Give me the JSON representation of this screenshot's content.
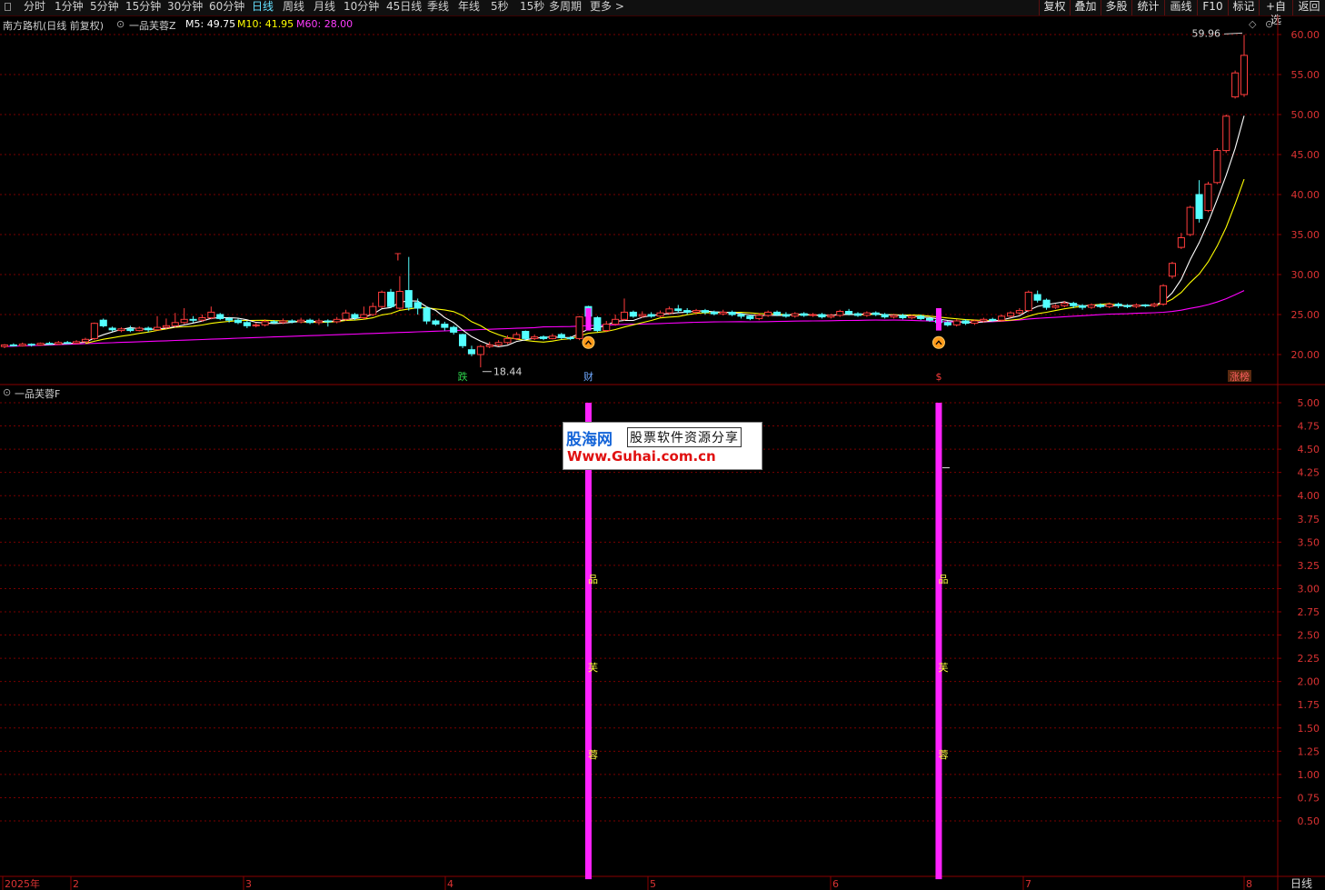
{
  "toolbar": {
    "periods": [
      "分时",
      "1分钟",
      "5分钟",
      "15分钟",
      "30分钟",
      "60分钟",
      "日线",
      "周线",
      "月线",
      "10分钟",
      "45日线",
      "季线",
      "年线",
      "5秒",
      "15秒",
      "多周期",
      "更多 >"
    ],
    "active_period": "日线",
    "right_buttons": [
      "复权",
      "叠加",
      "多股",
      "统计",
      "画线",
      "F10",
      "标记",
      "+自选",
      "返回"
    ]
  },
  "main_info": {
    "stock_label": "南方路机(日线 前复权)",
    "indicator_name": "一品芙蓉Z",
    "ma5_label": "M5: 49.75",
    "ma10_label": "M10: 41.95",
    "ma60_label": "M60: 28.00"
  },
  "sub_info": {
    "indicator_name": "一品芙蓉F"
  },
  "annotations": {
    "high_label": "59.96",
    "low_label": "18.44",
    "t_marker": "T",
    "bottom_markers": [
      "跌",
      "财",
      "$",
      "涨榜"
    ]
  },
  "sub_vertical_text": [
    "品",
    "芙",
    "蓉"
  ],
  "time_axis": {
    "labels": [
      "2025年",
      "2",
      "3",
      "4",
      "5",
      "6",
      "7",
      "8"
    ],
    "period_label": "日线"
  },
  "watermark": {
    "logo": "股海网",
    "slogan": "股票软件资源分享",
    "url": "Www.Guhai.com.cn"
  },
  "colors": {
    "up": "#ff3c3c",
    "down": "#54ffff",
    "ma5": "#ffffff",
    "ma10": "#ffff00",
    "ma60": "#ff00ff",
    "grid": "#7a0000",
    "signal": "#ff22ff"
  },
  "chart_data": [
    {
      "type": "candlestick",
      "title": "南方路机(日线 前复权)",
      "ylim": [
        18,
        62
      ],
      "y_ticks": [
        "60.00",
        "55.00",
        "50.00",
        "45.00",
        "40.00",
        "35.00",
        "30.00",
        "25.00",
        "20.00"
      ],
      "highest": 59.96,
      "lowest": 18.44,
      "series": [
        {
          "name": "M5",
          "last": 49.75
        },
        {
          "name": "M10",
          "last": 41.95
        },
        {
          "name": "M60",
          "last": 28.0
        }
      ],
      "candles": [
        [
          21.0,
          21.2,
          20.8,
          21.3
        ],
        [
          21.2,
          21.1,
          21.0,
          21.4
        ],
        [
          21.1,
          21.3,
          21.0,
          21.5
        ],
        [
          21.3,
          21.2,
          21.0,
          21.4
        ],
        [
          21.2,
          21.4,
          21.1,
          21.5
        ],
        [
          21.4,
          21.3,
          21.2,
          21.6
        ],
        [
          21.3,
          21.5,
          21.2,
          21.7
        ],
        [
          21.5,
          21.4,
          21.3,
          21.7
        ],
        [
          21.4,
          21.6,
          21.3,
          21.8
        ],
        [
          21.6,
          21.9,
          21.5,
          22.1
        ],
        [
          22.0,
          23.9,
          21.8,
          24.0
        ],
        [
          24.3,
          23.6,
          23.4,
          24.5
        ],
        [
          23.3,
          23.1,
          22.9,
          23.5
        ],
        [
          23.0,
          23.2,
          22.8,
          23.4
        ],
        [
          23.2,
          23.0,
          22.8,
          23.6
        ],
        [
          23.0,
          23.3,
          22.9,
          23.5
        ],
        [
          23.3,
          23.1,
          22.8,
          23.5
        ],
        [
          23.1,
          23.4,
          23.0,
          24.8
        ],
        [
          23.4,
          23.6,
          23.2,
          24.5
        ],
        [
          23.6,
          24.0,
          23.4,
          25.2
        ],
        [
          24.0,
          24.4,
          23.8,
          25.8
        ],
        [
          24.4,
          24.3,
          24.0,
          24.8
        ],
        [
          24.3,
          24.6,
          24.1,
          25.0
        ],
        [
          24.6,
          25.3,
          24.4,
          26.0
        ],
        [
          25.0,
          24.5,
          24.3,
          25.2
        ],
        [
          24.5,
          24.3,
          24.0,
          24.7
        ],
        [
          24.3,
          24.0,
          23.8,
          24.5
        ],
        [
          24.0,
          23.6,
          23.3,
          24.2
        ],
        [
          23.6,
          23.7,
          23.4,
          24.0
        ],
        [
          23.7,
          24.1,
          23.5,
          24.4
        ],
        [
          24.1,
          24.0,
          23.8,
          24.3
        ],
        [
          24.0,
          24.2,
          23.8,
          24.5
        ],
        [
          24.2,
          24.1,
          23.9,
          24.4
        ],
        [
          24.1,
          24.3,
          23.9,
          24.6
        ],
        [
          24.3,
          24.0,
          23.8,
          24.5
        ],
        [
          24.0,
          24.2,
          23.7,
          24.5
        ],
        [
          24.2,
          24.1,
          23.5,
          24.4
        ],
        [
          24.1,
          24.4,
          23.9,
          24.7
        ],
        [
          24.4,
          25.2,
          24.2,
          25.6
        ],
        [
          25.0,
          24.6,
          24.3,
          25.2
        ],
        [
          24.6,
          25.0,
          24.4,
          26.0
        ],
        [
          25.0,
          26.0,
          24.8,
          26.5
        ],
        [
          26.0,
          27.8,
          25.8,
          28.0
        ],
        [
          27.8,
          26.0,
          25.8,
          28.2
        ],
        [
          25.8,
          27.9,
          25.6,
          29.8
        ],
        [
          28.0,
          25.9,
          25.5,
          32.2
        ],
        [
          26.5,
          25.8,
          25.0,
          27.0
        ],
        [
          25.8,
          24.2,
          23.8,
          26.0
        ],
        [
          24.2,
          23.8,
          23.6,
          24.4
        ],
        [
          23.8,
          23.4,
          23.0,
          24.1
        ],
        [
          23.4,
          22.8,
          22.5,
          23.6
        ],
        [
          22.5,
          21.1,
          20.8,
          22.6
        ],
        [
          20.6,
          20.1,
          19.8,
          21.1
        ],
        [
          20.0,
          21.0,
          18.4,
          21.2
        ],
        [
          21.0,
          21.2,
          20.8,
          21.6
        ],
        [
          21.2,
          21.5,
          21.0,
          21.8
        ],
        [
          21.5,
          22.0,
          21.3,
          22.4
        ],
        [
          22.0,
          22.5,
          21.8,
          22.8
        ],
        [
          22.9,
          22.0,
          21.8,
          23.0
        ],
        [
          22.0,
          22.2,
          21.8,
          22.5
        ],
        [
          22.2,
          22.0,
          21.8,
          22.4
        ],
        [
          22.0,
          22.3,
          21.9,
          22.6
        ],
        [
          22.5,
          22.1,
          21.9,
          22.7
        ],
        [
          22.1,
          22.0,
          21.8,
          22.3
        ],
        [
          22.0,
          24.7,
          21.8,
          24.8
        ],
        [
          26.0,
          24.8,
          24.5,
          26.1
        ],
        [
          24.6,
          23.0,
          22.8,
          24.8
        ],
        [
          23.0,
          23.8,
          22.8,
          24.2
        ],
        [
          23.8,
          24.4,
          23.6,
          25.0
        ],
        [
          24.4,
          25.3,
          24.2,
          27.0
        ],
        [
          25.3,
          24.8,
          24.6,
          25.5
        ],
        [
          24.8,
          25.0,
          24.6,
          25.4
        ],
        [
          25.0,
          24.8,
          24.6,
          25.3
        ],
        [
          24.8,
          25.2,
          24.6,
          25.5
        ],
        [
          25.2,
          25.7,
          25.0,
          26.0
        ],
        [
          25.7,
          25.5,
          25.2,
          26.2
        ],
        [
          25.5,
          25.3,
          25.0,
          25.8
        ],
        [
          25.3,
          25.5,
          25.1,
          25.7
        ],
        [
          25.5,
          25.3,
          25.0,
          25.7
        ],
        [
          25.3,
          25.1,
          24.9,
          25.5
        ],
        [
          25.1,
          25.3,
          24.9,
          25.6
        ],
        [
          25.3,
          25.0,
          24.8,
          25.5
        ],
        [
          25.0,
          24.8,
          24.5,
          25.2
        ],
        [
          24.8,
          24.5,
          24.3,
          25.0
        ],
        [
          24.5,
          24.9,
          24.3,
          25.2
        ],
        [
          24.9,
          25.3,
          24.7,
          25.5
        ],
        [
          25.3,
          25.0,
          24.8,
          25.5
        ],
        [
          25.0,
          24.8,
          24.6,
          25.3
        ],
        [
          24.8,
          25.1,
          24.6,
          25.3
        ],
        [
          25.1,
          24.9,
          24.7,
          25.3
        ],
        [
          24.9,
          25.0,
          24.7,
          25.2
        ],
        [
          25.0,
          24.7,
          24.5,
          25.2
        ],
        [
          24.7,
          24.9,
          24.5,
          25.1
        ],
        [
          24.9,
          25.4,
          24.7,
          25.6
        ],
        [
          25.4,
          25.1,
          24.9,
          25.7
        ],
        [
          25.1,
          24.9,
          24.7,
          25.3
        ],
        [
          24.9,
          25.2,
          24.7,
          25.4
        ],
        [
          25.2,
          25.0,
          24.8,
          25.4
        ],
        [
          25.0,
          24.7,
          24.5,
          25.2
        ],
        [
          24.7,
          24.9,
          24.5,
          25.1
        ],
        [
          24.9,
          24.6,
          24.4,
          25.1
        ],
        [
          24.6,
          24.8,
          24.4,
          25.0
        ],
        [
          24.8,
          24.5,
          24.3,
          25.0
        ],
        [
          24.5,
          24.3,
          24.1,
          24.7
        ],
        [
          24.3,
          24.0,
          23.8,
          24.5
        ],
        [
          24.0,
          23.7,
          23.5,
          24.2
        ],
        [
          23.7,
          24.2,
          23.5,
          24.4
        ],
        [
          24.2,
          23.9,
          23.7,
          24.4
        ],
        [
          23.9,
          24.2,
          23.7,
          24.4
        ],
        [
          24.2,
          24.4,
          24.0,
          24.6
        ],
        [
          24.4,
          24.3,
          24.1,
          24.6
        ],
        [
          24.3,
          24.8,
          24.1,
          25.0
        ],
        [
          24.8,
          25.2,
          24.6,
          25.4
        ],
        [
          25.2,
          25.5,
          25.0,
          25.8
        ],
        [
          25.5,
          27.8,
          25.3,
          28.0
        ],
        [
          27.5,
          26.8,
          26.5,
          28.0
        ],
        [
          26.8,
          25.9,
          25.6,
          27.0
        ],
        [
          25.9,
          26.1,
          25.7,
          26.3
        ],
        [
          26.1,
          26.4,
          25.9,
          26.7
        ],
        [
          26.4,
          26.1,
          25.8,
          26.6
        ],
        [
          26.1,
          25.9,
          25.6,
          26.3
        ],
        [
          25.9,
          26.2,
          25.7,
          26.4
        ],
        [
          26.2,
          26.0,
          25.8,
          26.4
        ],
        [
          26.0,
          26.3,
          25.8,
          26.5
        ],
        [
          26.3,
          26.1,
          25.8,
          26.5
        ],
        [
          26.1,
          26.0,
          25.8,
          26.3
        ],
        [
          26.0,
          26.2,
          25.8,
          26.4
        ],
        [
          26.2,
          26.1,
          25.9,
          26.3
        ],
        [
          26.1,
          26.3,
          25.9,
          26.5
        ],
        [
          26.3,
          28.6,
          26.1,
          28.8
        ],
        [
          29.8,
          31.4,
          29.5,
          31.6
        ],
        [
          33.4,
          34.6,
          33.2,
          35.2
        ],
        [
          35.0,
          38.4,
          34.8,
          38.6
        ],
        [
          40.0,
          37.0,
          36.5,
          41.8
        ],
        [
          38.0,
          41.3,
          37.8,
          41.6
        ],
        [
          41.5,
          45.5,
          41.3,
          45.8
        ],
        [
          45.5,
          49.8,
          45.2,
          50.0
        ],
        [
          52.2,
          55.2,
          52.0,
          55.5
        ],
        [
          52.5,
          57.4,
          52.2,
          59.96
        ]
      ]
    },
    {
      "type": "bar",
      "title": "一品芙蓉F",
      "ylim": [
        0,
        5.2
      ],
      "y_ticks": [
        "5.00",
        "4.75",
        "4.50",
        "4.25",
        "4.00",
        "3.75",
        "3.50",
        "3.25",
        "3.00",
        "2.75",
        "2.50",
        "2.25",
        "2.00",
        "1.75",
        "1.50",
        "1.25",
        "1.00",
        "0.75",
        "0.50"
      ],
      "signals": [
        {
          "bar_index": 65,
          "value": 5.0
        },
        {
          "bar_index": 104,
          "value": 5.0
        }
      ],
      "level_mark": 4.3
    }
  ]
}
